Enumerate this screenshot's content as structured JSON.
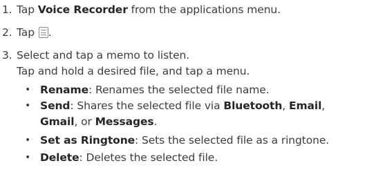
{
  "steps": [
    {
      "num": "1.",
      "pre": "Tap ",
      "bold": "Voice Recorder",
      "post": " from the applications menu."
    },
    {
      "num": "2.",
      "pre": "Tap ",
      "icon": "list-icon",
      "post": "."
    },
    {
      "num": "3.",
      "line1": "Select and tap a memo to listen.",
      "line2": "Tap and hold a desired file, and tap a menu."
    }
  ],
  "bullets": [
    {
      "bold": "Rename",
      "text": ": Renames the selected file name."
    },
    {
      "bold": "Send",
      "text": ": Shares the selected file via ",
      "b2": "Bluetooth",
      "sep1": ", ",
      "b3": "Email",
      "sep2": ",",
      "b4": "Gmail",
      "sep3": ", or ",
      "b5": "Messages",
      "end": "."
    },
    {
      "bold": "Set as Ringtone",
      "text": ": Sets the selected file as a ringtone."
    },
    {
      "bold": "Delete",
      "text": ": Deletes the selected file."
    }
  ],
  "bullet_char": "•"
}
